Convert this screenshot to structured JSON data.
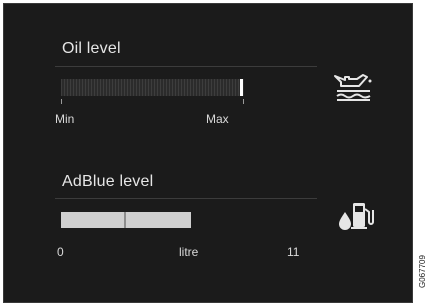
{
  "oil": {
    "title": "Oil level",
    "min_label": "Min",
    "max_label": "Max",
    "icon": "oil-can-level-icon"
  },
  "adblue": {
    "title": "AdBlue level",
    "zero_label": "0",
    "unit_label": "litre",
    "max_label": "11",
    "icon": "adblue-fuel-pump-icon"
  },
  "figure_code": "G067709",
  "colors": {
    "background": "#1b1b1b",
    "text": "#e6e6e6",
    "bar_fill": "#cfcfcf"
  }
}
